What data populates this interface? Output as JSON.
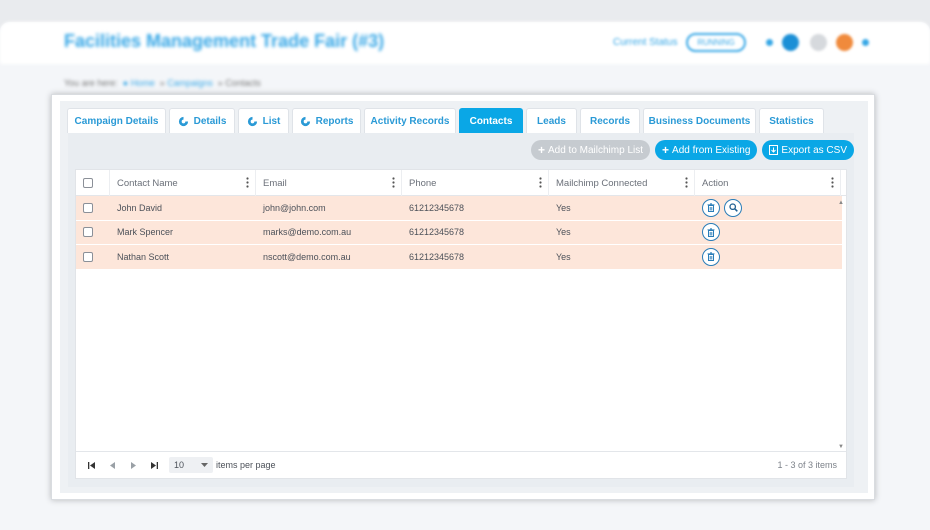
{
  "background": {
    "title": "Facilities Management Trade Fair (#3)",
    "status_label": "Current Status",
    "status_badge": "RUNNING",
    "breadcrumb_prefix": "You are here:",
    "breadcrumb": [
      "Home",
      "Campaigns",
      "Contacts"
    ]
  },
  "tabs": [
    {
      "label": "Campaign Details",
      "icon": "",
      "active": false
    },
    {
      "label": "Details",
      "icon": "swirl-icon",
      "active": false
    },
    {
      "label": "List",
      "icon": "swirl-icon",
      "active": false
    },
    {
      "label": "Reports",
      "icon": "swirl-icon",
      "active": false
    },
    {
      "label": "Activity Records",
      "icon": "",
      "active": false
    },
    {
      "label": "Contacts",
      "icon": "",
      "active": true
    },
    {
      "label": "Leads",
      "icon": "",
      "active": false
    },
    {
      "label": "Records",
      "icon": "",
      "active": false
    },
    {
      "label": "Business Documents",
      "icon": "",
      "active": false
    },
    {
      "label": "Statistics",
      "icon": "",
      "active": false
    }
  ],
  "toolbar": {
    "add_mailchimp": "Add to Mailchimp List",
    "add_existing": "Add from Existing",
    "export_csv": "Export as CSV"
  },
  "grid": {
    "columns": [
      "Contact Name",
      "Email",
      "Phone",
      "Mailchimp Connected",
      "Action"
    ],
    "rows": [
      {
        "name": "John David",
        "email": "john@john.com",
        "phone": "61212345678",
        "mailchimp": "Yes",
        "actions": [
          "delete",
          "view"
        ]
      },
      {
        "name": "Mark Spencer",
        "email": "marks@demo.com.au",
        "phone": "61212345678",
        "mailchimp": "Yes",
        "actions": [
          "delete"
        ]
      },
      {
        "name": "Nathan Scott",
        "email": "nscott@demo.com.au",
        "phone": "61212345678",
        "mailchimp": "Yes",
        "actions": [
          "delete"
        ]
      }
    ]
  },
  "pager": {
    "page_size": "10",
    "items_per_page": "items per page",
    "count": "1 - 3 of 3 items"
  },
  "colors": {
    "accent": "#0aa7e6",
    "row_highlight": "#fde6da",
    "disabled_button": "#c6cbd0"
  }
}
